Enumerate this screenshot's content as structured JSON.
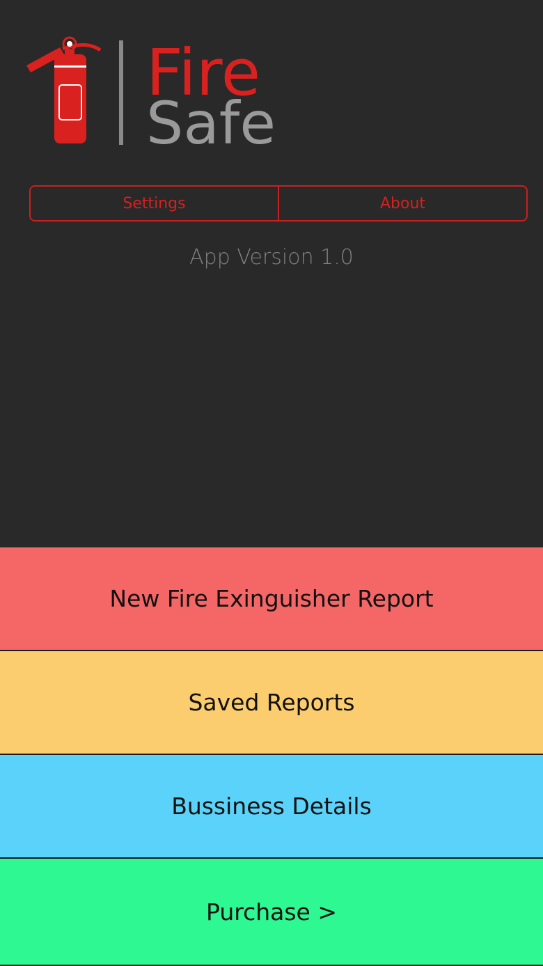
{
  "logo": {
    "word_top": "Fire",
    "word_bottom": "Safe",
    "colors": {
      "red": "#d9211f",
      "gray": "#9a9a9a",
      "divider": "#8a8a8a"
    }
  },
  "segmented": {
    "items": [
      {
        "label": "Settings"
      },
      {
        "label": "About"
      }
    ],
    "color": "#d4211f"
  },
  "version_text": "App Version 1.0",
  "menu": {
    "items": [
      {
        "label": "New Fire Exinguisher Report",
        "color": "#f46766"
      },
      {
        "label": "Saved Reports",
        "color": "#fbcd6f"
      },
      {
        "label": "Bussiness Details",
        "color": "#5bd2fa"
      },
      {
        "label": "Purchase >",
        "color": "#2ef892"
      }
    ]
  }
}
